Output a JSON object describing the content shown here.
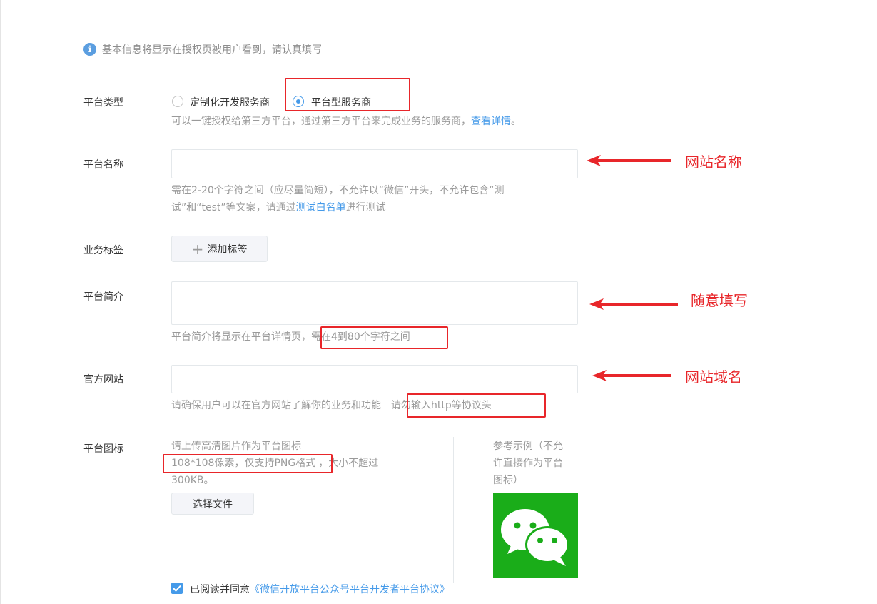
{
  "notice": "基本信息将显示在授权页被用户看到，请认真填写",
  "platform_type": {
    "label": "平台类型",
    "options": [
      "定制化开发服务商",
      "平台型服务商"
    ],
    "selected": "平台型服务商",
    "hint_prefix": "可以一键授权给第三方平台，通过第三方平台来完成业务的服务商，",
    "hint_link": "查看详情",
    "hint_suffix": "。"
  },
  "platform_name": {
    "label": "平台名称",
    "value": "",
    "hint_line1": "需在2-20个字符之间（应尽量简短），不允许以“微信”开头，不允许包含“测",
    "hint_line2_prefix": "试”和“test”等文案，请通过",
    "hint_link": "测试白名单",
    "hint_line2_suffix": "进行测试"
  },
  "business_tags": {
    "label": "业务标签",
    "add_button": "添加标签"
  },
  "platform_intro": {
    "label": "平台简介",
    "value": "",
    "hint_prefix": "平台简介将显示在平台详情页，",
    "hint_highlight": "需在4到80个字符之间"
  },
  "official_site": {
    "label": "官方网站",
    "value": "",
    "hint_prefix": "请确保用户可以在官方网站了解你的业务和功能",
    "hint_highlight": "请勿输入http等协议头"
  },
  "platform_icon": {
    "label": "平台图标",
    "desc_line1": "请上传高清图片作为平台图标",
    "desc_highlight": "108*108像素，仅支持PNG格式",
    "desc_suffix": "，大小不超过",
    "desc_line3": "300KB。",
    "choose_button": "选择文件",
    "example_line1": "参考示例（不允",
    "example_line2": "许直接作为平台",
    "example_line3": "图标）"
  },
  "agreement": {
    "checked": true,
    "prefix": "已阅读并同意",
    "link": "《微信开放平台公众号平台开发者平台协议》"
  },
  "annotations": {
    "site_name": "网站名称",
    "fill_freely": "随意填写",
    "site_domain": "网站域名"
  },
  "colors": {
    "accent": "#459ae9",
    "annotation": "#e8262a",
    "wechat_green": "#1aad19"
  }
}
